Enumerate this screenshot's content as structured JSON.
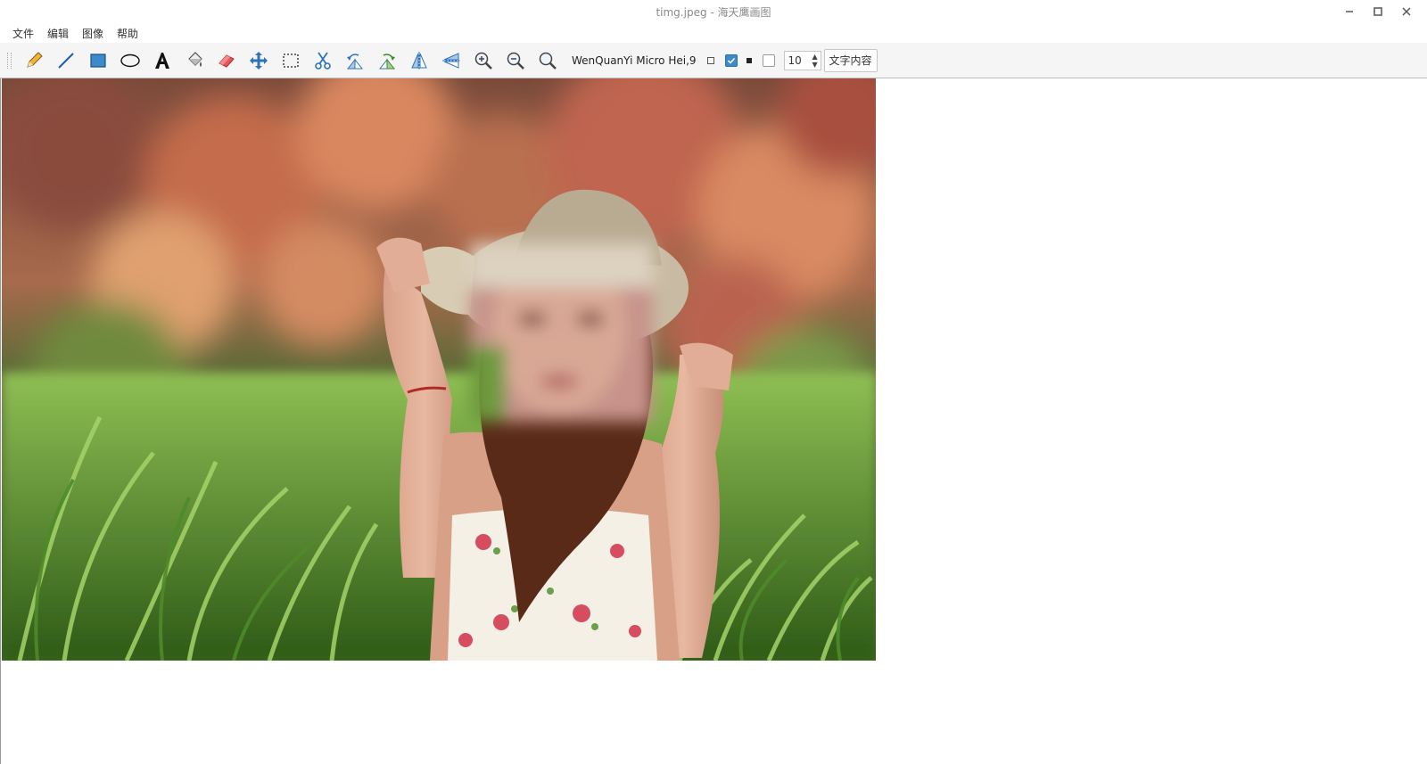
{
  "window": {
    "title": "timg.jpeg - 海天鹰画图"
  },
  "menu": {
    "items": [
      "文件",
      "编辑",
      "图像",
      "帮助"
    ]
  },
  "toolbar": {
    "tools": [
      "pencil-icon",
      "line-icon",
      "rectangle-icon",
      "ellipse-icon",
      "text-icon",
      "fill-bucket-icon",
      "eraser-icon",
      "move-icon",
      "select-rect-icon",
      "cut-icon",
      "rotate-left-icon",
      "rotate-right-icon",
      "flip-horizontal-icon",
      "flip-vertical-icon",
      "zoom-in-icon",
      "zoom-out-icon",
      "zoom-original-icon"
    ],
    "font_label": "WenQuanYi Micro Hei,9",
    "fill_checked": true,
    "outline_checked": false,
    "size_value": "10",
    "text_button": "文字内容"
  },
  "colors": {
    "accent": "#3d89c9",
    "toolbar_bg": "#f5f5f5"
  },
  "image": {
    "subject": "photo"
  }
}
